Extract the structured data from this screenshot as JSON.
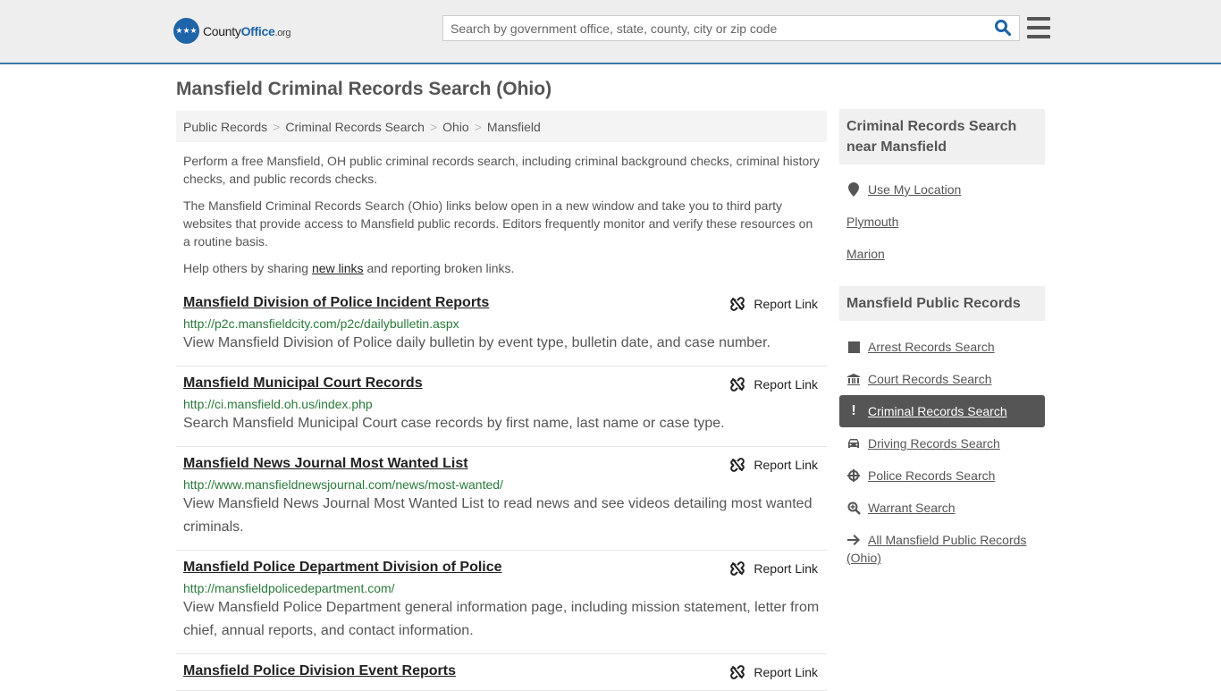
{
  "header": {
    "logo": {
      "part1": "County",
      "part2": "Office",
      "part3": ".org"
    },
    "search_placeholder": "Search by government office, state, county, city or zip code",
    "search_icon": "search-icon",
    "menu_icon": "hamburger-menu-icon"
  },
  "page_title": "Mansfield Criminal Records Search (Ohio)",
  "breadcrumb": [
    "Public Records",
    "Criminal Records Search",
    "Ohio",
    "Mansfield"
  ],
  "intro": {
    "p1": "Perform a free Mansfield, OH public criminal records search, including criminal background checks, criminal history checks, and public records checks.",
    "p2": "The Mansfield Criminal Records Search (Ohio) links below open in a new window and take you to third party websites that provide access to Mansfield public records. Editors frequently monitor and verify these resources on a routine basis.",
    "p3_before": "Help others by sharing ",
    "p3_link": "new links",
    "p3_after": " and reporting broken links."
  },
  "report_label": "Report Link",
  "results": [
    {
      "title": "Mansfield Division of Police Incident Reports",
      "url": "http://p2c.mansfieldcity.com/p2c/dailybulletin.aspx",
      "desc": "View Mansfield Division of Police daily bulletin by event type, bulletin date, and case number."
    },
    {
      "title": "Mansfield Municipal Court Records",
      "url": "http://ci.mansfield.oh.us/index.php",
      "desc": "Search Mansfield Municipal Court case records by first name, last name or case type."
    },
    {
      "title": "Mansfield News Journal Most Wanted List",
      "url": "http://www.mansfieldnewsjournal.com/news/most-wanted/",
      "desc": "View Mansfield News Journal Most Wanted List to read news and see videos detailing most wanted criminals."
    },
    {
      "title": "Mansfield Police Department Division of Police",
      "url": "http://mansfieldpolicedepartment.com/",
      "desc": "View Mansfield Police Department general information page, including mission statement, letter from chief, annual reports, and contact information."
    },
    {
      "title": "Mansfield Police Division Event Reports",
      "url": "",
      "desc": ""
    }
  ],
  "sidebar": {
    "nearby": {
      "heading": "Criminal Records Search near Mansfield",
      "items": [
        {
          "label": "Use My Location",
          "icon": "map-marker-icon"
        },
        {
          "label": "Plymouth",
          "icon": ""
        },
        {
          "label": "Marion",
          "icon": ""
        }
      ]
    },
    "public_records": {
      "heading": "Mansfield Public Records",
      "items": [
        {
          "label": "Arrest Records Search",
          "icon": "square-icon",
          "active": false
        },
        {
          "label": "Court Records Search",
          "icon": "courthouse-icon",
          "active": false
        },
        {
          "label": "Criminal Records Search",
          "icon": "exclamation-icon",
          "active": true
        },
        {
          "label": "Driving Records Search",
          "icon": "car-icon",
          "active": false
        },
        {
          "label": "Police Records Search",
          "icon": "crosshair-icon",
          "active": false
        },
        {
          "label": "Warrant Search",
          "icon": "magnify-plus-icon",
          "active": false
        },
        {
          "label": "All Mansfield Public Records (Ohio)",
          "icon": "arrow-right-icon",
          "active": false
        }
      ]
    }
  }
}
